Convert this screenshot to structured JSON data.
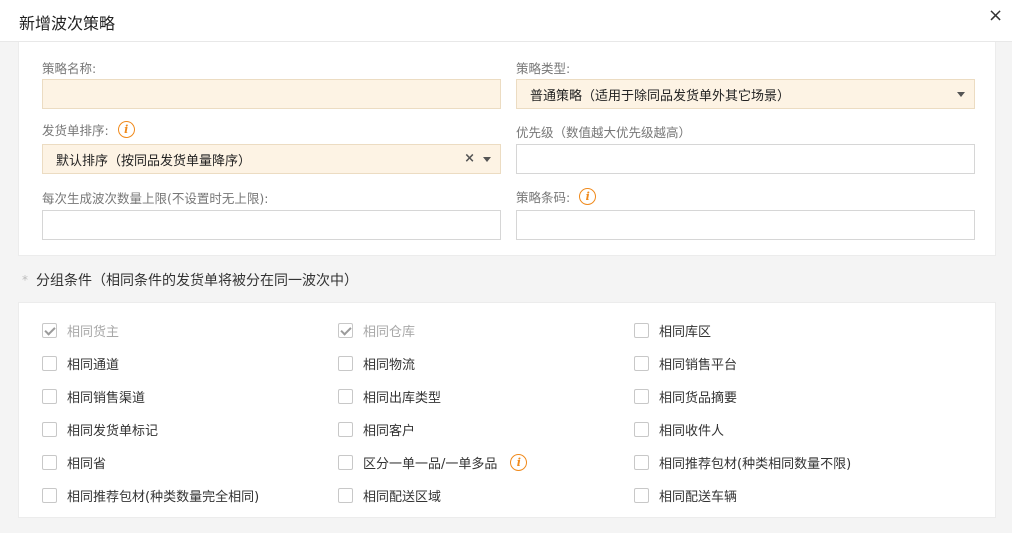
{
  "dialog": {
    "title": "新增波次策略",
    "close_glyph": "×"
  },
  "form": {
    "strategy_name": {
      "label": "策略名称:",
      "value": ""
    },
    "strategy_type": {
      "label": "策略类型:",
      "value": "普通策略（适用于除同品发货单外其它场景）"
    },
    "order_sort": {
      "label": "发货单排序:",
      "value": "默认排序（按同品发货单量降序）",
      "clear_glyph": "×"
    },
    "priority": {
      "label": "优先级（数值越大优先级越高）",
      "value": ""
    },
    "max_per_wave": {
      "label": "每次生成波次数量上限(不设置时无上限):",
      "value": ""
    },
    "barcode": {
      "label": "策略条码:",
      "value": ""
    }
  },
  "info_glyph": "i",
  "grouping": {
    "title": "分组条件（相同条件的发货单将被分在同一波次中）",
    "bullet": "*",
    "options": [
      {
        "label": "相同货主",
        "checked": true,
        "disabled": true
      },
      {
        "label": "相同仓库",
        "checked": true,
        "disabled": true
      },
      {
        "label": "相同库区",
        "checked": false,
        "disabled": false
      },
      {
        "label": "相同通道",
        "checked": false,
        "disabled": false
      },
      {
        "label": "相同物流",
        "checked": false,
        "disabled": false
      },
      {
        "label": "相同销售平台",
        "checked": false,
        "disabled": false
      },
      {
        "label": "相同销售渠道",
        "checked": false,
        "disabled": false
      },
      {
        "label": "相同出库类型",
        "checked": false,
        "disabled": false
      },
      {
        "label": "相同货品摘要",
        "checked": false,
        "disabled": false
      },
      {
        "label": "相同发货单标记",
        "checked": false,
        "disabled": false
      },
      {
        "label": "相同客户",
        "checked": false,
        "disabled": false
      },
      {
        "label": "相同收件人",
        "checked": false,
        "disabled": false
      },
      {
        "label": "相同省",
        "checked": false,
        "disabled": false
      },
      {
        "label": "区分一单一品/一单多品",
        "checked": false,
        "disabled": false
      },
      {
        "label": "相同推荐包材(种类相同数量不限)",
        "checked": false,
        "disabled": false
      },
      {
        "label": "相同推荐包材(种类数量完全相同)",
        "checked": false,
        "disabled": false
      },
      {
        "label": "相同配送区域",
        "checked": false,
        "disabled": false
      },
      {
        "label": "相同配送车辆",
        "checked": false,
        "disabled": false
      }
    ]
  },
  "colors": {
    "accent_orange": "#f08a1c",
    "required_bg": "#fdf3e4"
  }
}
